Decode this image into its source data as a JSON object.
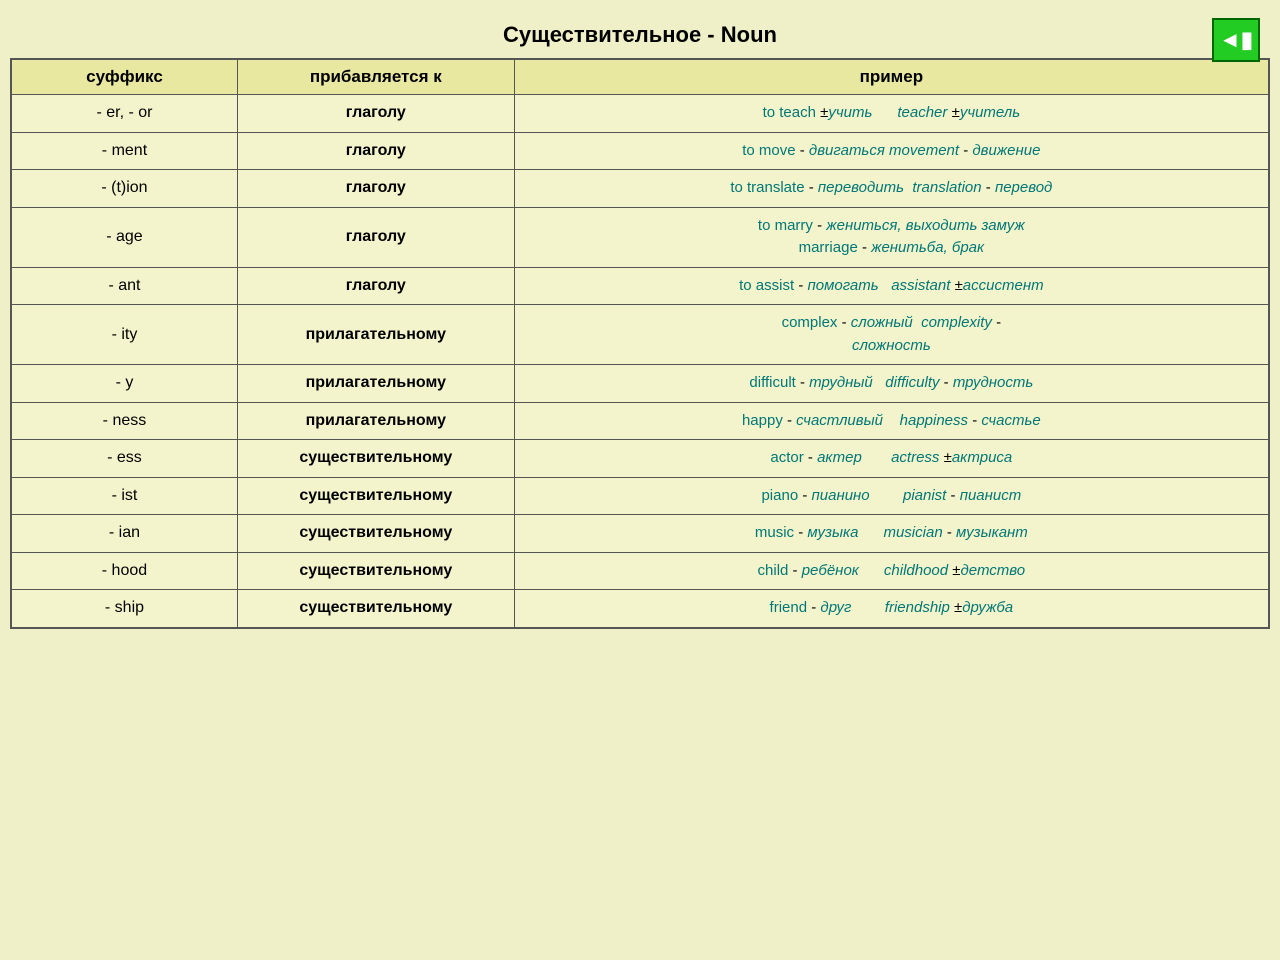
{
  "title": "Существительное - Noun",
  "nav_button_label": "◀|",
  "headers": {
    "suffix": "суффикс",
    "added_to": "прибавляется к",
    "example": "пример"
  },
  "rows": [
    {
      "suffix": "- er, - or",
      "added_to": "глаголу",
      "example_html": "er_or"
    },
    {
      "suffix": "- ment",
      "added_to": "глаголу",
      "example_html": "ment"
    },
    {
      "suffix": "- (t)ion",
      "added_to": "глаголу",
      "example_html": "tion"
    },
    {
      "suffix": "- age",
      "added_to": "глаголу",
      "example_html": "age"
    },
    {
      "suffix": "- ant",
      "added_to": "глаголу",
      "example_html": "ant"
    },
    {
      "suffix": "- ity",
      "added_to": "прилагательному",
      "example_html": "ity"
    },
    {
      "suffix": "- y",
      "added_to": "прилагательному",
      "example_html": "y"
    },
    {
      "suffix": "- ness",
      "added_to": "прилагательному",
      "example_html": "ness"
    },
    {
      "suffix": "- ess",
      "added_to": "существительному",
      "example_html": "ess"
    },
    {
      "suffix": "- ist",
      "added_to": "существительному",
      "example_html": "ist"
    },
    {
      "suffix": "- ian",
      "added_to": "существительному",
      "example_html": "ian"
    },
    {
      "suffix": "- hood",
      "added_to": "существительному",
      "example_html": "hood"
    },
    {
      "suffix": "- ship",
      "added_to": "существительному",
      "example_html": "ship"
    }
  ]
}
